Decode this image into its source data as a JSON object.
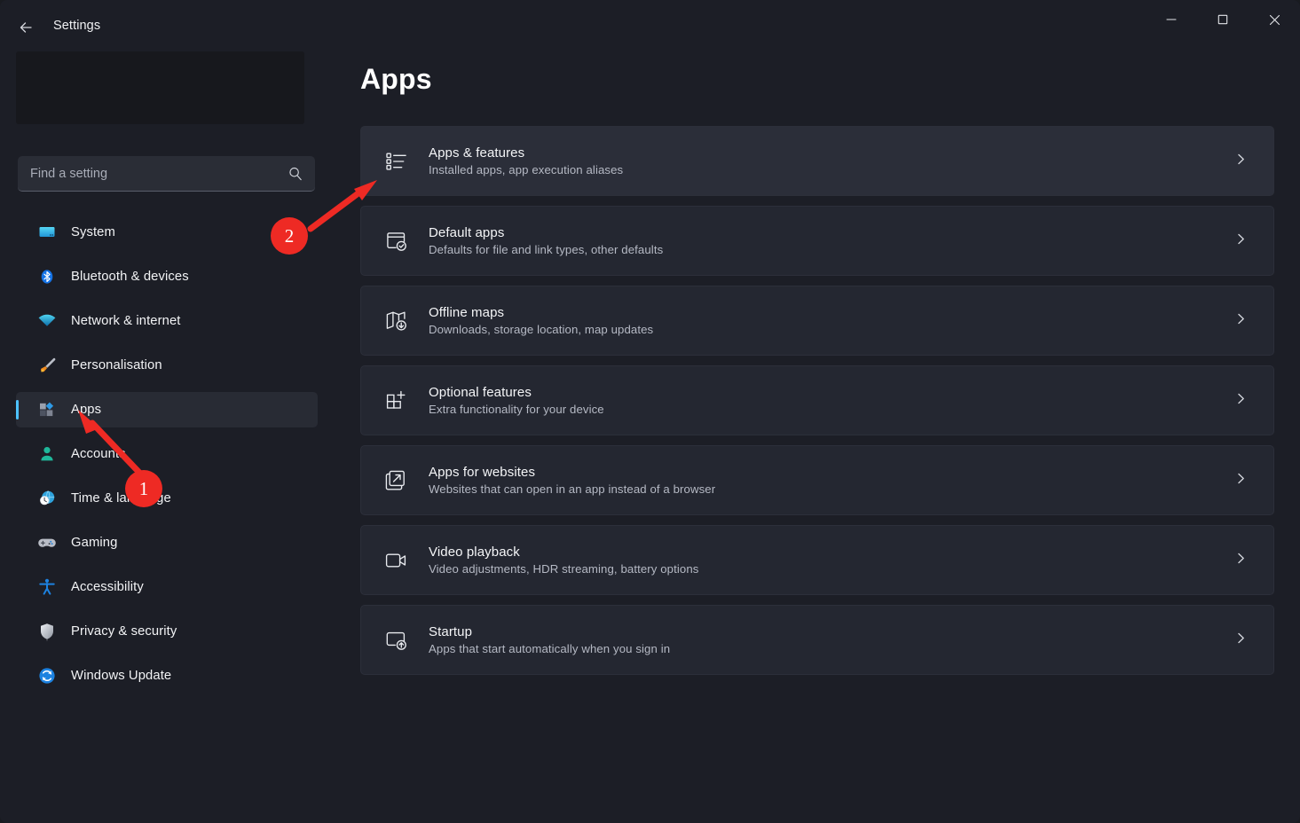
{
  "window": {
    "title": "Settings",
    "back_icon": "back-arrow-icon",
    "controls": {
      "minimize": "minimize-icon",
      "maximize": "maximize-icon",
      "close": "close-icon"
    }
  },
  "sidebar": {
    "search": {
      "placeholder": "Find a setting",
      "icon": "search-icon"
    },
    "items": [
      {
        "label": "System",
        "icon": "monitor-icon",
        "selected": false
      },
      {
        "label": "Bluetooth & devices",
        "icon": "bluetooth-icon",
        "selected": false
      },
      {
        "label": "Network & internet",
        "icon": "wifi-icon",
        "selected": false
      },
      {
        "label": "Personalisation",
        "icon": "paintbrush-icon",
        "selected": false
      },
      {
        "label": "Apps",
        "icon": "apps-blocks-icon",
        "selected": true
      },
      {
        "label": "Accounts",
        "icon": "person-icon",
        "selected": false
      },
      {
        "label": "Time & language",
        "icon": "clock-globe-icon",
        "selected": false
      },
      {
        "label": "Gaming",
        "icon": "gamepad-icon",
        "selected": false
      },
      {
        "label": "Accessibility",
        "icon": "accessibility-icon",
        "selected": false
      },
      {
        "label": "Privacy & security",
        "icon": "shield-icon",
        "selected": false
      },
      {
        "label": "Windows Update",
        "icon": "update-refresh-icon",
        "selected": false
      }
    ]
  },
  "main": {
    "title": "Apps",
    "cards": [
      {
        "title": "Apps & features",
        "subtitle": "Installed apps, app execution aliases",
        "icon": "list-bullets-icon",
        "hovered": true
      },
      {
        "title": "Default apps",
        "subtitle": "Defaults for file and link types, other defaults",
        "icon": "window-check-icon",
        "hovered": false
      },
      {
        "title": "Offline maps",
        "subtitle": "Downloads, storage location, map updates",
        "icon": "map-download-icon",
        "hovered": false
      },
      {
        "title": "Optional features",
        "subtitle": "Extra functionality for your device",
        "icon": "grid-plus-icon",
        "hovered": false
      },
      {
        "title": "Apps for websites",
        "subtitle": "Websites that can open in an app instead of a browser",
        "icon": "external-link-icon",
        "hovered": false
      },
      {
        "title": "Video playback",
        "subtitle": "Video adjustments, HDR streaming, battery options",
        "icon": "video-camera-icon",
        "hovered": false
      },
      {
        "title": "Startup",
        "subtitle": "Apps that start automatically when you sign in",
        "icon": "window-uparrow-icon",
        "hovered": false
      }
    ],
    "chevron_icon": "chevron-right-icon"
  },
  "annotations": {
    "color": "#ee2a24",
    "markers": [
      {
        "number": "1",
        "points_to": "sidebar-item-apps"
      },
      {
        "number": "2",
        "points_to": "card-apps-and-features"
      }
    ]
  },
  "colors": {
    "accent": "#4cc2ff",
    "window_bg": "#1c1e26",
    "card_bg": "#242731",
    "card_bg_hover": "#2b2e39",
    "annotation_red": "#ee2a24"
  }
}
